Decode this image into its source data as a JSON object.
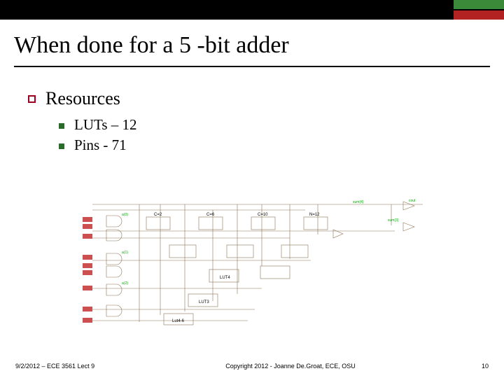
{
  "title": "When done for a 5 -bit adder",
  "bullets": {
    "level1": "Resources",
    "level2": [
      "LUTs – 12",
      "Pins - 71"
    ]
  },
  "footer": {
    "left": "9/2/2012 – ECE 3561 Lect 9",
    "center": "Copyright 2012 - Joanne De.Groat, ECE, OSU",
    "right": "10"
  },
  "diagram": {
    "description": "Schematic of synthesized 5-bit adder logic with LUTs and routing",
    "segments": [
      "C=2",
      "C=6",
      "C=10",
      "N=12"
    ],
    "style": {
      "stroke": "#8b7355",
      "signal": "#00aa00",
      "pin": "#cc5050"
    }
  },
  "colors": {
    "rule_red": "#a00020",
    "rule_green": "#2a6a2a",
    "bar_green": "#3a8a3a",
    "bar_red": "#b22222"
  }
}
